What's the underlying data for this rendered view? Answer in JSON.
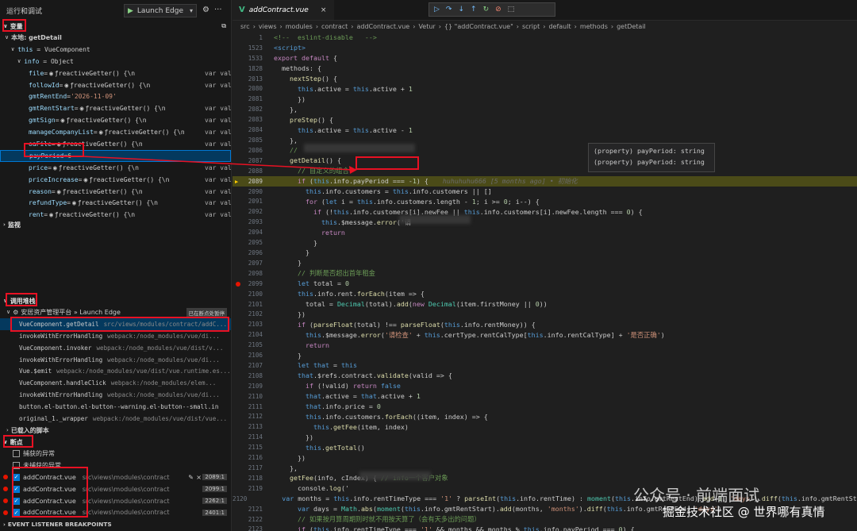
{
  "sidebar": {
    "title": "运行和调试",
    "launch_config": "Launch Edge",
    "variables": {
      "header": "变量",
      "scope": "本地: getDetail",
      "this_line": {
        "name": "this",
        "value": "VueComponent"
      },
      "info_line": {
        "name": "info",
        "value": "Object"
      },
      "rows": [
        {
          "name": "file",
          "value": "ƒ reactiveGetter() {\\n",
          "right": "var valu..."
        },
        {
          "name": "followId",
          "value": "ƒ reactiveGetter() {\\n",
          "right": "var val..."
        },
        {
          "name": "gmtRentEnd",
          "value": "'2026-11-09'",
          "right": ""
        },
        {
          "name": "gmtRentStart",
          "value": "ƒ reactiveGetter() {\\n",
          "right": "var val..."
        },
        {
          "name": "gmtSign",
          "value": "ƒ reactiveGetter() {\\n",
          "right": "var val..."
        },
        {
          "name": "manageCompanyList",
          "value": "ƒ reactiveGetter() {\\n",
          "right": "var val..."
        },
        {
          "name": "oaFile",
          "value": "ƒ reactiveGetter() {\\n",
          "right": "var val..."
        },
        {
          "name": "payPeriod",
          "value": "6",
          "right": ""
        },
        {
          "name": "price",
          "value": "ƒ reactiveGetter() {\\n",
          "right": "var val..."
        },
        {
          "name": "priceIncrease",
          "value": "ƒ reactiveGetter() {\\n",
          "right": "var val..."
        },
        {
          "name": "reason",
          "value": "ƒ reactiveGetter() {\\n",
          "right": "var val..."
        },
        {
          "name": "refundType",
          "value": "ƒ reactiveGetter() {\\n",
          "right": "var val..."
        },
        {
          "name": "rent",
          "value": "ƒ reactiveGetter() {\\n",
          "right": "var val..."
        }
      ]
    },
    "watch_header": "监视",
    "callstack": {
      "header": "调用堆栈",
      "session": "安居资产管理平台 » Launch Edge",
      "session_badge": "已在断点处暂停",
      "frames": [
        {
          "fn": "VueComponent.getDetail",
          "path": "src/views/modules/contract/addC..."
        },
        {
          "fn": "invokeWithErrorHandling",
          "path": "webpack:/node_modules/vue/di..."
        },
        {
          "fn": "VueComponent.invoker",
          "path": "webpack:/node_modules/vue/dist/v..."
        },
        {
          "fn": "invokeWithErrorHandling",
          "path": "webpack:/node_modules/vue/di..."
        },
        {
          "fn": "Vue.$emit",
          "path": "webpack:/node_modules/vue/dist/vue.runtime.es..."
        },
        {
          "fn": "VueComponent.handleClick",
          "path": "webpack:/node_modules/elem..."
        },
        {
          "fn": "invokeWithErrorHandling",
          "path": "webpack:/node_modules/vue/di..."
        },
        {
          "fn": "button.el-button.el-button--warning.el-button--small.in",
          "path": ""
        },
        {
          "fn": "original_1._wrapper",
          "path": "webpack:/node_modules/vue/dist/vue..."
        }
      ],
      "loaded_scripts": "已载入的脚本"
    },
    "breakpoints": {
      "header": "断点",
      "caught": "捕获的异常",
      "uncaught": "未捕获的异常",
      "items": [
        {
          "file": "addContract.vue",
          "path": "src\\views\\modules\\contract",
          "line": "2089:1"
        },
        {
          "file": "addContract.vue",
          "path": "src\\views\\modules\\contract",
          "line": "2099:1"
        },
        {
          "file": "addContract.vue",
          "path": "src\\views\\modules\\contract",
          "line": "2262:1"
        },
        {
          "file": "addContract.vue",
          "path": "src\\views\\modules\\contract",
          "line": "2401:1"
        }
      ],
      "event_listeners": "EVENT LISTENER BREAKPOINTS"
    }
  },
  "editor": {
    "tab": "addContract.vue",
    "breadcrumb": [
      "src",
      "views",
      "modules",
      "contract",
      "addContract.vue",
      "Vetur",
      "{} \"addContract.vue\"",
      "script",
      "default",
      "methods",
      "getDetail"
    ],
    "hover_lines": [
      "(property) payPeriod: string",
      "(property) payPeriod: string"
    ],
    "blame": "huhuhuhu666 [5 months ago] • 初始化",
    "lines": [
      {
        "n": "1",
        "code": "<!--  eslint-disable   -->"
      },
      {
        "n": "1523",
        "code": "<script>"
      },
      {
        "n": "1533",
        "code": "export default {"
      },
      {
        "n": "1828",
        "code": "  methods: {"
      },
      {
        "n": "2013",
        "code": "    nextStep() {"
      },
      {
        "n": "2080",
        "code": "      this.active = this.active + 1"
      },
      {
        "n": "2081",
        "code": "      })"
      },
      {
        "n": "2082",
        "code": "    },"
      },
      {
        "n": "2083",
        "code": "    preStep() {"
      },
      {
        "n": "2084",
        "code": "      this.active = this.active - 1"
      },
      {
        "n": "2085",
        "code": "    },"
      },
      {
        "n": "2086",
        "code": "    // "
      },
      {
        "n": "2087",
        "code": "    getDetail() {"
      },
      {
        "n": "2088",
        "code": "      // 自定义的组合"
      },
      {
        "n": "2089",
        "code": "      if (this.info.payPeriod === -1) {"
      },
      {
        "n": "2090",
        "code": "        this.info.customers = this.info.customers || []"
      },
      {
        "n": "2091",
        "code": "        for (let i = this.info.customers.length - 1; i >= 0; i--) {"
      },
      {
        "n": "2092",
        "code": "          if (!this.info.customers[i].newFee || this.info.customers[i].newFee.length === 0) {"
      },
      {
        "n": "2093",
        "code": "            this.$message.error('请"
      },
      {
        "n": "2094",
        "code": "            return"
      },
      {
        "n": "2095",
        "code": "          }"
      },
      {
        "n": "2096",
        "code": "        }"
      },
      {
        "n": "2097",
        "code": "      }"
      },
      {
        "n": "2098",
        "code": "      // 判断是否超出首年租金"
      },
      {
        "n": "2099",
        "code": "      let total = 0"
      },
      {
        "n": "2100",
        "code": "      this.info.rent.forEach(item => {"
      },
      {
        "n": "2101",
        "code": "        total = Decimal(total).add(new Decimal(item.firstMoney || 0))"
      },
      {
        "n": "2102",
        "code": "      })"
      },
      {
        "n": "2103",
        "code": "      if (parseFloat(total) !== parseFloat(this.info.rentMoney)) {"
      },
      {
        "n": "2104",
        "code": "        this.$message.error('请检查' + this.certType.rentCalType[this.info.rentCalType] + '是否正确')"
      },
      {
        "n": "2105",
        "code": "        return"
      },
      {
        "n": "2106",
        "code": "      }"
      },
      {
        "n": "2107",
        "code": "      let that = this"
      },
      {
        "n": "2108",
        "code": "      that.$refs.contract.validate(valid => {"
      },
      {
        "n": "2109",
        "code": "        if (!valid) return false"
      },
      {
        "n": "2110",
        "code": "        that.active = that.active + 1"
      },
      {
        "n": "2111",
        "code": "        that.info.price = 0"
      },
      {
        "n": "2112",
        "code": "        this.info.customers.forEach((item, index) => {"
      },
      {
        "n": "2113",
        "code": "          this.getFee(item, index)"
      },
      {
        "n": "2114",
        "code": "        })"
      },
      {
        "n": "2115",
        "code": "        this.getTotal()"
      },
      {
        "n": "2116",
        "code": "      })"
      },
      {
        "n": "2117",
        "code": "    },"
      },
      {
        "n": "2118",
        "code": "    getFee(info, cIndex) { // info一个客户对象"
      },
      {
        "n": "2119",
        "code": "      console.log('"
      },
      {
        "n": "2120",
        "code": "      var months = this.info.rentTimeType === '1' ? parseInt(this.info.rentTime) : moment(this.info.gmtRentEnd).add(1, 'days').diff(this.info.gmtRentStart, 'months')"
      },
      {
        "n": "2121",
        "code": "      var days = Math.abs(moment(this.info.gmtRentStart).add(months, 'months').diff(this.info.gmtRentEnd, 'days'))"
      },
      {
        "n": "2122",
        "code": "      // 如果按月算周期则时就不用按天算了（会有天多出的问题）"
      },
      {
        "n": "2123",
        "code": "      if (this.info.rentTimeType === '1' && months && months % this.info.payPeriod === 0) {"
      }
    ]
  },
  "watermarks": {
    "w1": "公众号 · 前端面试",
    "w2": "掘金技术社区 @ 世界哪有真情"
  }
}
